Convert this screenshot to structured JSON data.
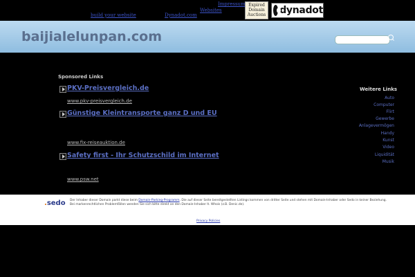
{
  "top": {
    "links": [
      {
        "text": "Impressum",
        "color": "#3d54c9"
      },
      {
        "text": "Websites",
        "color": "#3d54c9"
      },
      {
        "text": "build your website",
        "color": "#3d54c9"
      },
      {
        "text": "Dynadot.com",
        "color": "#3d54c9"
      }
    ],
    "expired_badge": {
      "line1": "Expired",
      "line2": "Domain",
      "line3": "Auctions"
    },
    "dynadot_logo": {
      "text": "dynadot",
      "icon": "dynadot-mark-icon"
    }
  },
  "header": {
    "site_title": "baijialelunpan.com",
    "search": {
      "placeholder": "",
      "icon": "search-icon"
    },
    "gradient": [
      "#bcdaf0",
      "#8fbde0"
    ]
  },
  "sponsored": {
    "heading": "Sponsored Links",
    "ads": [
      {
        "title": "PKV-Preisvergleich.de",
        "url": "www.pkv-preisvergleich.de"
      },
      {
        "title": "Günstige Kleintransporte ganz D und EU",
        "url": "www.fix-reiseauktion.de"
      },
      {
        "title": "Safety first - Ihr Schutzschild im Internet",
        "url": "www.psw.net"
      }
    ]
  },
  "related": {
    "heading": "Weitere Links",
    "items": [
      "Auto",
      "Computer",
      "Flirt",
      "Gewerbe",
      "Anlagevermögen",
      "Handy",
      "Kunst",
      "Video",
      "Liquidität",
      "Musik"
    ]
  },
  "footer": {
    "logo_text": "sedo",
    "text_part1": "Der Inhaber dieser Domain parkt diese beim ",
    "link_text": "Domain-Parking-Programm",
    "text_part2": ". Die auf dieser Seite bereitgestellten Listings kommen von dritter Seite und stehen mit Domain-Inhaber oder Sedo in keiner Beziehung. Bei markenrechtlichen Problemfällen wenden Sie sich bitte direkt an den Domain-Inhaber lt. Whois (z.B. Denic.de).",
    "privacy": "Privacy Policies"
  },
  "colors": {
    "link": "#5b6fc4",
    "background": "#000000",
    "title": "#5a6f8e"
  }
}
